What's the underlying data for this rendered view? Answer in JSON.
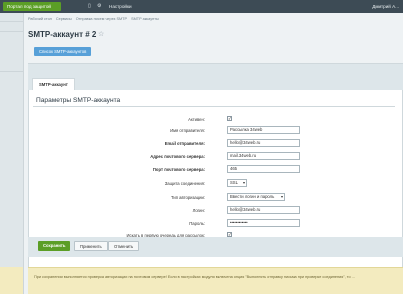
{
  "topbar": {
    "portal_button": "Портал под защитой",
    "icon_left": "▯",
    "icon_gear": "⚙",
    "settings_label": "Настройки",
    "user_label": "Дмитрий А..."
  },
  "breadcrumb": [
    "Рабочий стол",
    "Сервисы",
    "Отправка писем через SMTP",
    "SMTP аккаунты"
  ],
  "page": {
    "title": "SMTP-аккаунт # 2",
    "star_icon": "☆",
    "list_button": "Список SMTP-аккаунтов",
    "tab_label": "SMTP-аккаунт"
  },
  "panel": {
    "title": "Параметры SMTP-аккаунта",
    "active_label": "Активен:",
    "active_checked": true,
    "sender_name_label": "Имя отправителя:",
    "sender_name_value": "Рассылка 34web",
    "sender_email_label": "Email отправителя:",
    "sender_email_value": "hello@34web.ru",
    "server_address_label": "Адрес почтового сервера:",
    "server_address_value": "mail.34web.ru",
    "server_port_label": "Порт почтового сервера:",
    "server_port_value": "465",
    "security_label": "Защита соединения:",
    "security_value": "SSL",
    "auth_type_label": "Тип авторизации:",
    "auth_type_value": "Ввести логин и пароль",
    "login_label": "Логин:",
    "login_value": "hello@34web.ru",
    "password_label": "Пароль:",
    "password_value": "••••••••••••",
    "first_queue_label": "Искать в первую очередь для рассылок:",
    "first_queue_checked": true
  },
  "buttons": {
    "save": "Сохранить",
    "apply": "Применить",
    "cancel": "Отменить"
  },
  "note": "При сохранении выполняется проверка авторизации на почтовом сервере! Если в настройках модуля включена опция \"Выполнять отправку письма при проверке соединения\", то ..."
}
